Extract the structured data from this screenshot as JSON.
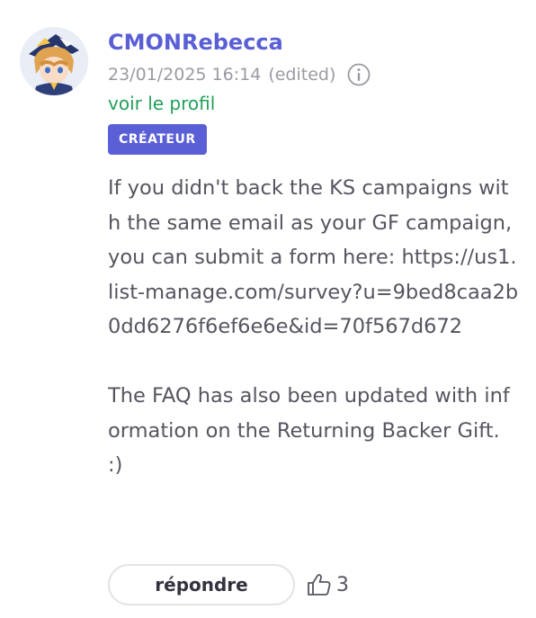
{
  "comment": {
    "username": "CMONRebecca",
    "timestamp": "23/01/2025 16:14",
    "edited_label": "(edited)",
    "profile_link": "voir le profil",
    "badge": "CRÉATEUR",
    "body": {
      "paragraph1": "If you didn't back the KS campaigns with the same email as your GF campaign, you can submit a form here: https://us1.list-manage.com/survey?u=9bed8caa2b0dd6276f6ef6e6e&id=70f567d672",
      "paragraph2": "The FAQ has also been updated with information on the Returning Backer Gift. :)"
    },
    "reply_label": "répondre",
    "like_count": "3"
  },
  "colors": {
    "username": "#5a5fd6",
    "badge_bg": "#5a5fd6",
    "profile_link": "#22a05a",
    "meta": "#9a9aa2",
    "body_text": "#555560"
  },
  "icons": {
    "avatar": "user-avatar-illustration",
    "info": "info-icon",
    "like": "thumbs-up-icon"
  }
}
